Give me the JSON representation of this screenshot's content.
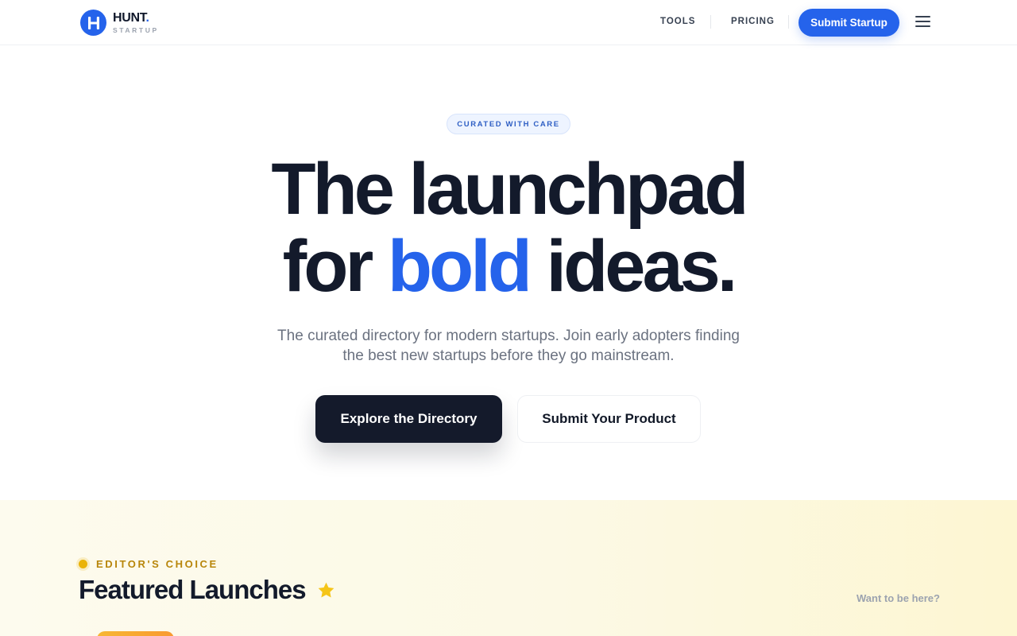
{
  "header": {
    "logo_name": "HUNT",
    "logo_dot": ".",
    "logo_sub": "STARTUP",
    "nav": {
      "tools": "TOOLS",
      "pricing": "PRICING"
    },
    "cta": "Submit Startup"
  },
  "hero": {
    "badge": "CURATED WITH CARE",
    "title_line1": "The launchpad",
    "title_pre": "for ",
    "title_accent": "bold",
    "title_post": " ideas.",
    "subtitle_line1": "The curated directory for modern startups. Join early adopters finding",
    "subtitle_line2": "the best new startups before they go mainstream.",
    "primary_button": "Explore the Directory",
    "secondary_button": "Submit Your Product"
  },
  "featured": {
    "eyebrow": "EDITOR'S CHOICE",
    "title": "Featured Launches",
    "link": "Want to be here?"
  },
  "colors": {
    "accent": "#2563eb",
    "dark": "#141a2b",
    "gold": "#eab308"
  },
  "icons": [
    "logo-h-icon",
    "menu-icon",
    "star-icon"
  ]
}
